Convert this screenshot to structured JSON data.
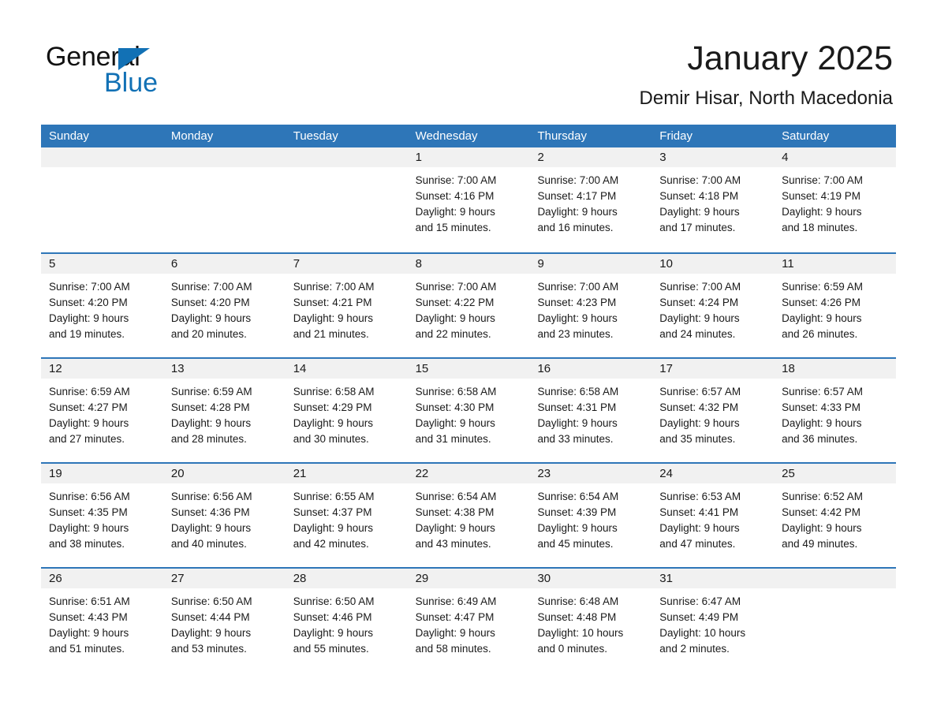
{
  "brand": {
    "name_part1": "General",
    "name_part2": "Blue",
    "flag_icon": "triangle-flag-icon",
    "accent_color": "#1271b5"
  },
  "header": {
    "month_title": "January 2025",
    "location": "Demir Hisar, North Macedonia"
  },
  "colors": {
    "header_blue": "#2e76b8",
    "day_bar_gray": "#f1f1f1",
    "text": "#1a1a1a"
  },
  "calendar": {
    "weekday_headers": [
      "Sunday",
      "Monday",
      "Tuesday",
      "Wednesday",
      "Thursday",
      "Friday",
      "Saturday"
    ],
    "weeks": [
      [
        {
          "day": "",
          "lines": []
        },
        {
          "day": "",
          "lines": []
        },
        {
          "day": "",
          "lines": []
        },
        {
          "day": "1",
          "lines": [
            "Sunrise: 7:00 AM",
            "Sunset: 4:16 PM",
            "Daylight: 9 hours",
            "and 15 minutes."
          ]
        },
        {
          "day": "2",
          "lines": [
            "Sunrise: 7:00 AM",
            "Sunset: 4:17 PM",
            "Daylight: 9 hours",
            "and 16 minutes."
          ]
        },
        {
          "day": "3",
          "lines": [
            "Sunrise: 7:00 AM",
            "Sunset: 4:18 PM",
            "Daylight: 9 hours",
            "and 17 minutes."
          ]
        },
        {
          "day": "4",
          "lines": [
            "Sunrise: 7:00 AM",
            "Sunset: 4:19 PM",
            "Daylight: 9 hours",
            "and 18 minutes."
          ]
        }
      ],
      [
        {
          "day": "5",
          "lines": [
            "Sunrise: 7:00 AM",
            "Sunset: 4:20 PM",
            "Daylight: 9 hours",
            "and 19 minutes."
          ]
        },
        {
          "day": "6",
          "lines": [
            "Sunrise: 7:00 AM",
            "Sunset: 4:20 PM",
            "Daylight: 9 hours",
            "and 20 minutes."
          ]
        },
        {
          "day": "7",
          "lines": [
            "Sunrise: 7:00 AM",
            "Sunset: 4:21 PM",
            "Daylight: 9 hours",
            "and 21 minutes."
          ]
        },
        {
          "day": "8",
          "lines": [
            "Sunrise: 7:00 AM",
            "Sunset: 4:22 PM",
            "Daylight: 9 hours",
            "and 22 minutes."
          ]
        },
        {
          "day": "9",
          "lines": [
            "Sunrise: 7:00 AM",
            "Sunset: 4:23 PM",
            "Daylight: 9 hours",
            "and 23 minutes."
          ]
        },
        {
          "day": "10",
          "lines": [
            "Sunrise: 7:00 AM",
            "Sunset: 4:24 PM",
            "Daylight: 9 hours",
            "and 24 minutes."
          ]
        },
        {
          "day": "11",
          "lines": [
            "Sunrise: 6:59 AM",
            "Sunset: 4:26 PM",
            "Daylight: 9 hours",
            "and 26 minutes."
          ]
        }
      ],
      [
        {
          "day": "12",
          "lines": [
            "Sunrise: 6:59 AM",
            "Sunset: 4:27 PM",
            "Daylight: 9 hours",
            "and 27 minutes."
          ]
        },
        {
          "day": "13",
          "lines": [
            "Sunrise: 6:59 AM",
            "Sunset: 4:28 PM",
            "Daylight: 9 hours",
            "and 28 minutes."
          ]
        },
        {
          "day": "14",
          "lines": [
            "Sunrise: 6:58 AM",
            "Sunset: 4:29 PM",
            "Daylight: 9 hours",
            "and 30 minutes."
          ]
        },
        {
          "day": "15",
          "lines": [
            "Sunrise: 6:58 AM",
            "Sunset: 4:30 PM",
            "Daylight: 9 hours",
            "and 31 minutes."
          ]
        },
        {
          "day": "16",
          "lines": [
            "Sunrise: 6:58 AM",
            "Sunset: 4:31 PM",
            "Daylight: 9 hours",
            "and 33 minutes."
          ]
        },
        {
          "day": "17",
          "lines": [
            "Sunrise: 6:57 AM",
            "Sunset: 4:32 PM",
            "Daylight: 9 hours",
            "and 35 minutes."
          ]
        },
        {
          "day": "18",
          "lines": [
            "Sunrise: 6:57 AM",
            "Sunset: 4:33 PM",
            "Daylight: 9 hours",
            "and 36 minutes."
          ]
        }
      ],
      [
        {
          "day": "19",
          "lines": [
            "Sunrise: 6:56 AM",
            "Sunset: 4:35 PM",
            "Daylight: 9 hours",
            "and 38 minutes."
          ]
        },
        {
          "day": "20",
          "lines": [
            "Sunrise: 6:56 AM",
            "Sunset: 4:36 PM",
            "Daylight: 9 hours",
            "and 40 minutes."
          ]
        },
        {
          "day": "21",
          "lines": [
            "Sunrise: 6:55 AM",
            "Sunset: 4:37 PM",
            "Daylight: 9 hours",
            "and 42 minutes."
          ]
        },
        {
          "day": "22",
          "lines": [
            "Sunrise: 6:54 AM",
            "Sunset: 4:38 PM",
            "Daylight: 9 hours",
            "and 43 minutes."
          ]
        },
        {
          "day": "23",
          "lines": [
            "Sunrise: 6:54 AM",
            "Sunset: 4:39 PM",
            "Daylight: 9 hours",
            "and 45 minutes."
          ]
        },
        {
          "day": "24",
          "lines": [
            "Sunrise: 6:53 AM",
            "Sunset: 4:41 PM",
            "Daylight: 9 hours",
            "and 47 minutes."
          ]
        },
        {
          "day": "25",
          "lines": [
            "Sunrise: 6:52 AM",
            "Sunset: 4:42 PM",
            "Daylight: 9 hours",
            "and 49 minutes."
          ]
        }
      ],
      [
        {
          "day": "26",
          "lines": [
            "Sunrise: 6:51 AM",
            "Sunset: 4:43 PM",
            "Daylight: 9 hours",
            "and 51 minutes."
          ]
        },
        {
          "day": "27",
          "lines": [
            "Sunrise: 6:50 AM",
            "Sunset: 4:44 PM",
            "Daylight: 9 hours",
            "and 53 minutes."
          ]
        },
        {
          "day": "28",
          "lines": [
            "Sunrise: 6:50 AM",
            "Sunset: 4:46 PM",
            "Daylight: 9 hours",
            "and 55 minutes."
          ]
        },
        {
          "day": "29",
          "lines": [
            "Sunrise: 6:49 AM",
            "Sunset: 4:47 PM",
            "Daylight: 9 hours",
            "and 58 minutes."
          ]
        },
        {
          "day": "30",
          "lines": [
            "Sunrise: 6:48 AM",
            "Sunset: 4:48 PM",
            "Daylight: 10 hours",
            "and 0 minutes."
          ]
        },
        {
          "day": "31",
          "lines": [
            "Sunrise: 6:47 AM",
            "Sunset: 4:49 PM",
            "Daylight: 10 hours",
            "and 2 minutes."
          ]
        },
        {
          "day": "",
          "lines": []
        }
      ]
    ]
  }
}
